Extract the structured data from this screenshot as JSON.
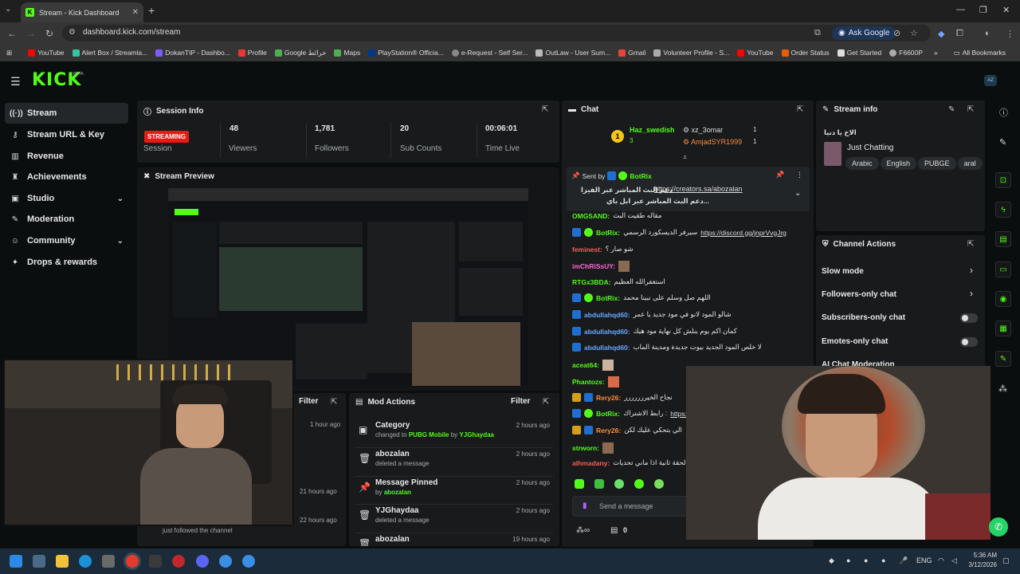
{
  "browser": {
    "tab_title": "Stream - Kick Dashboard",
    "url": "dashboard.kick.com/stream",
    "ask_google": "Ask Google",
    "bookmarks": [
      "YouTube",
      "Alert Box / Streamla...",
      "DokanTIP - Dashbo...",
      "Profile",
      "Google خرائط",
      "Maps",
      "PlayStation® Officia...",
      "e-Request - Self Ser...",
      "OutLaw - User Sum...",
      "Gmail",
      "Volunteer Profile - S...",
      "YouTube",
      "Order Status",
      "Get Started",
      "F6600P"
    ],
    "all_bookmarks": "All Bookmarks"
  },
  "header": {
    "logo": "KICK",
    "beta": "BETA",
    "avatar": "AZ"
  },
  "sidebar": {
    "items": [
      {
        "label": "Stream",
        "icon": "stream-icon"
      },
      {
        "label": "Stream URL & Key",
        "icon": "link-icon"
      },
      {
        "label": "Revenue",
        "icon": "revenue-icon"
      },
      {
        "label": "Achievements",
        "icon": "trophy-icon"
      },
      {
        "label": "Studio",
        "icon": "studio-icon"
      },
      {
        "label": "Moderation",
        "icon": "wrench-icon"
      },
      {
        "label": "Community",
        "icon": "community-icon"
      },
      {
        "label": "Drops & rewards",
        "icon": "gift-icon"
      }
    ]
  },
  "session": {
    "title": "Session Info",
    "status_badge": "STREAMING",
    "status_label": "Session",
    "viewers": "48",
    "viewers_label": "Viewers",
    "followers": "1,781",
    "followers_label": "Followers",
    "subs": "20",
    "subs_label": "Sub Counts",
    "time": "00:06:01",
    "time_label": "Time Live"
  },
  "preview": {
    "title": "Stream Preview"
  },
  "activity": {
    "filter": "Filter",
    "times": [
      "1 hour ago",
      "21 hours ago",
      "22 hours ago"
    ],
    "last_text": "just followed the channel"
  },
  "mod_actions": {
    "title": "Mod Actions",
    "filter": "Filter",
    "items": [
      {
        "title": "Category",
        "sub_prefix": "changed to",
        "sub_highlight": "PUBG Mobile",
        "sub_mid": "by",
        "sub_user": "YJGhaydaa",
        "time": "2 hours ago"
      },
      {
        "title": "abozalan",
        "sub": "deleted a message",
        "time": "2 hours ago"
      },
      {
        "title": "Message Pinned",
        "sub_prefix": "by",
        "sub_user": "abozalan",
        "time": "2 hours ago"
      },
      {
        "title": "YJGhaydaa",
        "sub": "deleted a message",
        "time": "2 hours ago"
      },
      {
        "title": "abozalan",
        "time": "19 hours ago"
      }
    ]
  },
  "chat": {
    "title": "Chat",
    "top_gifter_rank": "1",
    "top": [
      {
        "name": "Haz_swedish",
        "count": "3"
      },
      {
        "name": "xz_3omar",
        "count": "1"
      },
      {
        "name": "AmjadSYR1999",
        "count": "1"
      }
    ],
    "pinned": {
      "sent_by": "Sent by",
      "user": "BotRix",
      "line1_ar": "دعم البث المباشر عبر الفيزا",
      "link": "https://creators.sa/abozalan",
      "line2_ar": "دعم البث المباشر عبر ابل باي..."
    },
    "messages": [
      {
        "user": "OMGSAND:",
        "text": "مقاله طقيت البث",
        "cls": "u-g"
      },
      {
        "user": "BotRix:",
        "text": "سيرفر الديسكورد الرسمي",
        "link": "https://discord.gg/jnprVvgJrg",
        "cls": "u-g"
      },
      {
        "user": "feminest:",
        "text": "شو صار ؟",
        "cls": "u-r"
      },
      {
        "user": "imChRiSsUY:",
        "text": "",
        "cls": "u-p"
      },
      {
        "user": "RTGx3BDA:",
        "text": "استغفرالله العظيم",
        "cls": "u-g"
      },
      {
        "user": "BotRix:",
        "text": "اللهم صل وسلم على نبينا محمد",
        "cls": "u-g"
      },
      {
        "user": "abdullahqd60:",
        "text": "شالو المود لانو في مود جديد يا عمر",
        "cls": "u-b"
      },
      {
        "user": "abdullahqd60:",
        "text": "كمان اكم يوم بنلش كل نهاية مود هيك",
        "cls": "u-b"
      },
      {
        "user": "abdullahqd60:",
        "text": "لا خلص المود الجديد بيوت جديدة ومدينة الماب",
        "cls": "u-b"
      },
      {
        "user": "aceat64:",
        "text": "",
        "cls": "u-g"
      },
      {
        "user": "Phantozs:",
        "text": "",
        "cls": "u-g"
      },
      {
        "user": "Rery26:",
        "text": "نجاح الخيررررررر",
        "cls": "u-o"
      },
      {
        "user": "BotRix:",
        "text": "رابط الاشتراك :",
        "link": "https://k",
        "cls": "u-g"
      },
      {
        "user": "Rery26:",
        "text": "الي بتحكي عليك لكن",
        "cls": "u-o"
      },
      {
        "user": "strworn:",
        "text": "",
        "cls": "u-g"
      },
      {
        "user": "alhmadany:",
        "text": "لحقة ثانية اذا ماني تحديات",
        "cls": "u-r"
      }
    ],
    "send_placeholder": "Send a message",
    "points": "0"
  },
  "stream_info": {
    "title": "Stream info",
    "stream_title": "الاخ يا دنيا",
    "category": "Just Chatting",
    "tags": [
      "Arabic",
      "English",
      "PUBGE",
      "aral"
    ]
  },
  "channel_actions": {
    "title": "Channel Actions",
    "rows": [
      "Slow mode",
      "Followers-only chat",
      "Subscribers-only chat",
      "Emotes-only chat",
      "AI Chat Moderation"
    ]
  },
  "taskbar": {
    "lang": "ENG",
    "time": "5:36 AM",
    "date": "3/12/2026"
  },
  "colors": {
    "brand": "#53fc18",
    "live": "#e91916",
    "panel": "#181a1b",
    "bg": "#0b0e0f"
  }
}
